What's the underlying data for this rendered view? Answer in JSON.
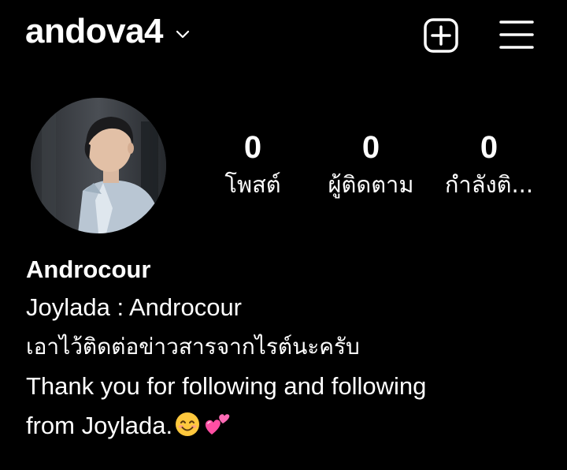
{
  "header": {
    "username": "andova4",
    "icons": {
      "switch_account": "chevron-down-icon",
      "new_post": "plus-square-icon",
      "menu": "hamburger-menu-icon"
    }
  },
  "profile": {
    "avatar_icon": "profile-photo",
    "stats": [
      {
        "count": "0",
        "label": "โพสต์"
      },
      {
        "count": "0",
        "label": "ผู้ติดตาม"
      },
      {
        "count": "0",
        "label": "กำลังติ..."
      }
    ],
    "display_name": "Androcour",
    "bio": {
      "line1": "Joylada : Androcour",
      "line2": "เอาไว้ติดต่อข่าวสารจากไรต์นะครับ",
      "line3": "Thank you for following and following",
      "line4": "from Joylada.",
      "emojis": [
        "smiling-face-emoji",
        "two-hearts-emoji"
      ]
    }
  },
  "colors": {
    "background": "#000000",
    "text": "#ffffff",
    "heart": "#ff4fa3",
    "emoji_face": "#ffc83d"
  }
}
